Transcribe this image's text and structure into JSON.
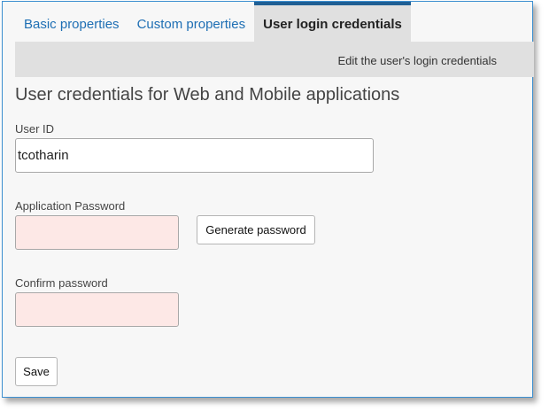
{
  "tabs": [
    {
      "label": "Basic properties",
      "active": false
    },
    {
      "label": "Custom properties",
      "active": false
    },
    {
      "label": "User login credentials",
      "active": true
    }
  ],
  "subheader": {
    "text": "Edit the user's login credentials"
  },
  "section": {
    "title": "User credentials for Web and Mobile applications"
  },
  "form": {
    "user_id_label": "User ID",
    "user_id_value": "tcotharin",
    "app_password_label": "Application Password",
    "app_password_value": "",
    "generate_button_label": "Generate password",
    "confirm_password_label": "Confirm password",
    "confirm_password_value": "",
    "save_button_label": "Save"
  },
  "colors": {
    "tab_link": "#1e6fb4",
    "active_tab_border": "#1f5f94",
    "frame_border": "#3d8fd0",
    "password_field_bg": "#fde8e6"
  }
}
